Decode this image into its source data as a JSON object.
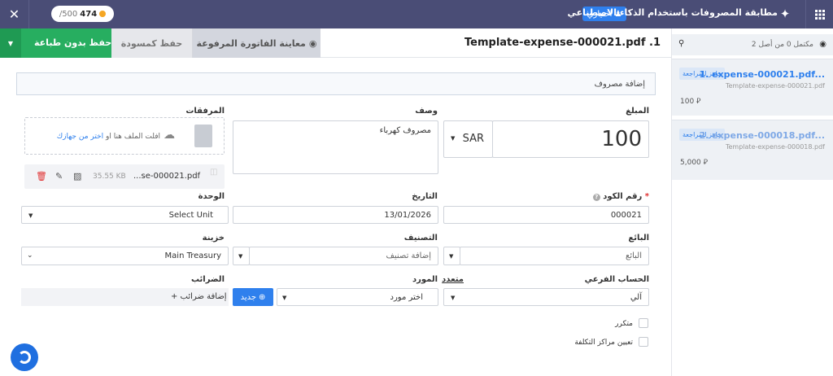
{
  "topbar": {
    "title": "مطابقة المصروفات باستخدام الذكاء الاصطناعي",
    "optional_badge": "اختياري",
    "credits_used": "474",
    "credits_total": "/500"
  },
  "tabs": {
    "save_no_print": "حفظ بدون طباعة",
    "save_draft": "حفظ كمسودة",
    "preview": "معاينة الفاتورة المرفوعة",
    "doc_title": "Template-expense-000021.pdf .1"
  },
  "sidebar": {
    "summary": "مكتمل 0 من أصل 2",
    "items": [
      {
        "name": "1. expense-000021.pdf...",
        "tag": "جاهز للمراجعة",
        "sub": "Template-expense-000021.pdf",
        "amount": "100"
      },
      {
        "name": "2. expense-000018.pdf...",
        "tag": "جاهز للمراجعة",
        "sub": "Template-expense-000018.pdf",
        "amount": "5,000"
      }
    ]
  },
  "form": {
    "section_title": "إضافة مصروف",
    "amount_label": "المبلغ",
    "amount_value": "100",
    "currency": "SAR",
    "description_label": "وصف",
    "description_value": "مصروف كهرباء",
    "attachments_label": "المرفقات",
    "drop_text": "افلت الملف هنا او",
    "drop_link": "اختر من جهازك",
    "file_name": "...se-000021.pdf",
    "file_size": "35.55 KB",
    "code_label": "رقم الكود",
    "code_value": "000021",
    "date_label": "التاريخ",
    "date_value": "13/01/2026",
    "unit_label": "الوحدة",
    "unit_value": "Select Unit",
    "vendor_label": "البائع",
    "vendor_value": "البائع",
    "category_label": "التصنيف",
    "category_value": "إضافة تصنيف",
    "treasury_label": "خزينة",
    "treasury_value": "Main Treasury",
    "subaccount_label": "الحساب الفرعي",
    "subaccount_value": "آلي",
    "multi_label": "متعدد",
    "supplier_label": "المورد",
    "supplier_value": "اختر مورد",
    "new_btn": "جديد",
    "taxes_label": "الضرائب",
    "add_tax": "إضافة ضرائب +",
    "recurring_label": "متكرر",
    "cost_centers_label": "تعيين مراكز التكلفة"
  }
}
